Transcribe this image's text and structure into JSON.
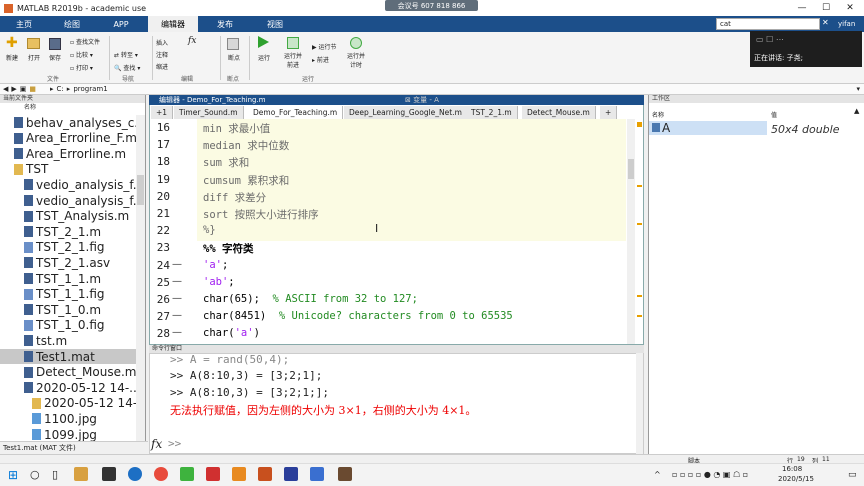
{
  "window": {
    "title": "MATLAB R2019b - academic use",
    "meeting": "会议号 607 818 866",
    "user": "yifan"
  },
  "ribbon_tabs": [
    "主页",
    "绘图",
    "APP",
    "编辑器",
    "发布",
    "视图"
  ],
  "search": {
    "value": "cat"
  },
  "ribbon": {
    "new": "新建",
    "open": "打开",
    "save": "保存",
    "find_files": "查找文件",
    "compare": "比较",
    "print": "打印",
    "goto": "转至",
    "find": "查找",
    "insert": "插入",
    "comment": "注释",
    "indent": "缩进",
    "fx": "fx",
    "breakpoint": "断点",
    "run": "运行",
    "run_advance": "运行并\n前进",
    "run_section": "运行节",
    "advance": "前进",
    "run_time": "运行并\n计时",
    "groups": {
      "file": "文件",
      "nav": "导航",
      "edit": "编辑",
      "bp": "断点",
      "run": "运行"
    }
  },
  "path": {
    "drive": "C:",
    "folder": "program1"
  },
  "current_folder": {
    "header": "当前文件夹",
    "col_name": "名称",
    "files": [
      "behav_analyses_c...",
      "Area_Errorline_F.m",
      "Area_Errorline.m",
      "TST",
      "vedio_analysis_f...",
      "vedio_analysis_f...",
      "TST_Analysis.m",
      "TST_2_1.m",
      "TST_2_1.fig",
      "TST_2_1.asv",
      "TST_1_1.m",
      "TST_1_1.fig",
      "TST_1_0.m",
      "TST_1_0.fig",
      "tst.m",
      "Test1.mat",
      "Detect_Mouse.m",
      "2020-05-12 14-...",
      "2020-05-12 14-...",
      "1100.jpg",
      "1099.jpg"
    ]
  },
  "editor": {
    "header": "编辑器 - Demo_For_Teaching.m",
    "var_header": "变量 - A",
    "tabs": [
      "+1",
      "Timer_Sound.m",
      "Demo_For_Teaching.m",
      "Deep_Learning_Google_Net.m",
      "TST_2_1.m",
      "Detect_Mouse.m",
      "+"
    ],
    "lines": [
      {
        "n": "16",
        "d": "",
        "t": "min 求最小值"
      },
      {
        "n": "17",
        "d": "",
        "t": "median 求中位数"
      },
      {
        "n": "18",
        "d": "",
        "t": "sum 求和"
      },
      {
        "n": "19",
        "d": "",
        "t": "cumsum 累积求和"
      },
      {
        "n": "20",
        "d": "",
        "t": "diff 求差分"
      },
      {
        "n": "21",
        "d": "",
        "t": "sort 按照大小进行排序"
      },
      {
        "n": "22",
        "d": "",
        "t": "%}"
      },
      {
        "n": "23",
        "d": "",
        "t": "%% 字符类"
      },
      {
        "n": "24",
        "d": "—",
        "t": "'a';"
      },
      {
        "n": "25",
        "d": "—",
        "t": "'ab';"
      },
      {
        "n": "26",
        "d": "—",
        "t": "char(65);",
        "c": "% ASCII from 32 to 127;"
      },
      {
        "n": "27",
        "d": "—",
        "t": "char(8451)",
        "c": "% Unicode? characters from 0 to 65535"
      },
      {
        "n": "28",
        "d": "—",
        "t": "char('a')"
      }
    ]
  },
  "command": {
    "header": "命令行窗口",
    "lines": [
      ">> A = rand(50,4);",
      ">> A(8:10,3) = [3;2;1];",
      ">> A(8:10,3) = [3;2;1;];"
    ],
    "error": "无法执行赋值，因为左侧的大小为 3×1，右侧的大小为 4×1。",
    "prompt": ">>",
    "fx": "fx"
  },
  "workspace": {
    "header": "工作区",
    "col_name": "名称",
    "col_value": "值",
    "var_name": "A",
    "var_value": "50x4 double"
  },
  "status": {
    "text": "Test1.mat (MAT 文件)",
    "script": "脚本",
    "row": "行",
    "row_v": "19",
    "col": "列",
    "col_v": "11"
  },
  "notification": {
    "text": "正在讲话: 子尧;"
  },
  "clock": {
    "time": "16:08",
    "date": "2020/5/15"
  },
  "colors": {
    "ribbon_blue": "#1c4f8a",
    "section_highlight": "#fbfbe3",
    "error_red": "#e00000"
  }
}
